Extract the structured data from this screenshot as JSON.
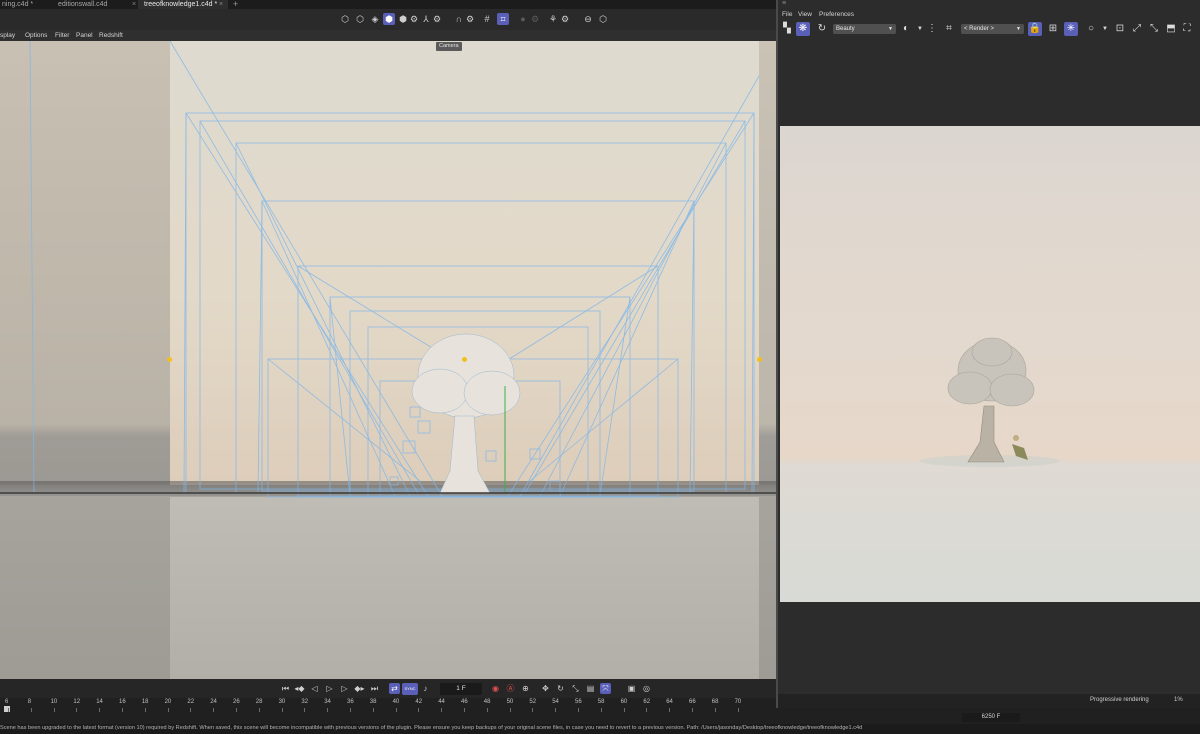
{
  "tabs": [
    {
      "label": "ning.c4d *",
      "active": false
    },
    {
      "label": "editionswall.c4d",
      "active": false
    },
    {
      "label": "treeofknowledge1.c4d *",
      "active": true
    }
  ],
  "tab_close_glyph": "×",
  "tab_add_glyph": "+",
  "viewport_menu": [
    "splay",
    "Options",
    "Filter",
    "Panel",
    "Redshift"
  ],
  "camera_label": "Camera",
  "transport": {
    "frame_value": "1 F",
    "fps_label": "SYNC"
  },
  "timeline": {
    "ticks": [
      "6",
      "8",
      "10",
      "12",
      "14",
      "16",
      "18",
      "20",
      "22",
      "24",
      "26",
      "28",
      "30",
      "32",
      "34",
      "36",
      "38",
      "40",
      "42",
      "44",
      "46",
      "48",
      "50",
      "52",
      "54",
      "56",
      "58",
      "60",
      "62",
      "64",
      "66",
      "68",
      "70"
    ],
    "end_frame": "6250 F"
  },
  "status_text": "Scene has been upgraded to the latest format (version 10) required by Redshift. When saved, this scene will become incompatible with previous versions of the plugin. Please ensure you keep backups of your original scene files, in case you need to revert to a previous version. Path: /Users/jasonday/Desktop/treeofknowledge/treeofknowledge1.c4d",
  "render_view": {
    "menu": [
      "File",
      "View",
      "Preferences"
    ],
    "aov_select": "Beauty",
    "camera_select": "< Render >",
    "progress_label": "Progressive rendering",
    "progress_value": "1%"
  },
  "colors": {
    "accent": "#5a5fb8",
    "wireframe": "#7fb6ea",
    "handle": "#f0c020"
  }
}
